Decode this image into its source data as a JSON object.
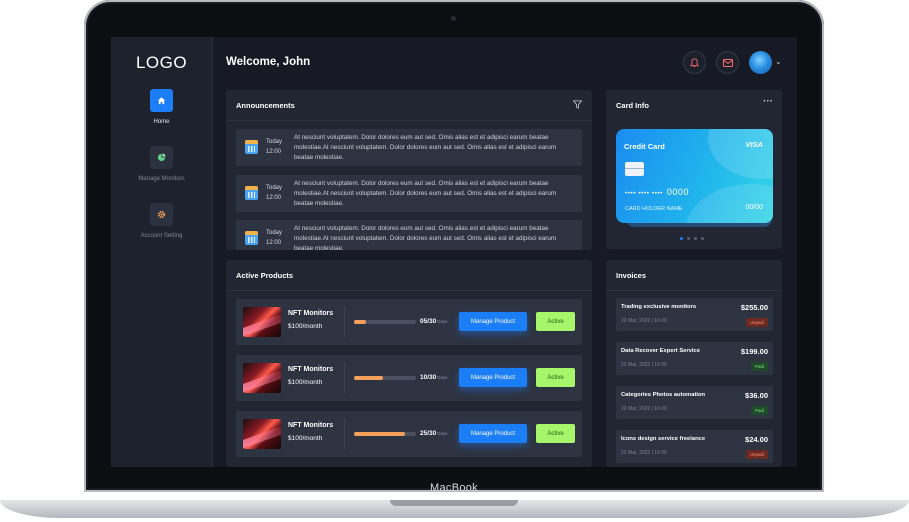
{
  "device": {
    "label": "MacBook"
  },
  "sidebar": {
    "logo": "LOGO",
    "items": [
      {
        "label": "Home",
        "icon": "home-icon",
        "active": true
      },
      {
        "label": "Manage Monitors",
        "icon": "pie-chart-icon",
        "active": false
      },
      {
        "label": "Account Setting",
        "icon": "gear-icon",
        "active": false
      }
    ]
  },
  "header": {
    "welcome": "Welcome, John",
    "icons": [
      "bell-icon",
      "mail-icon",
      "avatar"
    ]
  },
  "announcements": {
    "title": "Announcements",
    "items": [
      {
        "day": "Today",
        "time": "12:00",
        "text": "At nesciunt voluptatem. Dolor dolores eum aut sed. Omis alias est et adipisci earum beatae molestiae.At nesciunt voluptatem. Dolor dolores eum aut sed. Omis alias est et adipisci earum beatae molestiae."
      },
      {
        "day": "Today",
        "time": "12:00",
        "text": "At nesciunt voluptatem. Dolor dolores eum aut sed. Omis alias est et adipisci earum beatae molestiae.At nesciunt voluptatem. Dolor dolores eum aut sed. Omis alias est et adipisci earum beatae molestiae."
      },
      {
        "day": "Today",
        "time": "12:00",
        "text": "At nesciunt voluptatem. Dolor dolores eum aut sed. Omis alias est et adipisci earum beatae molestiae.At nesciunt voluptatem. Dolor dolores eum aut sed. Omis alias est et adipisci earum beatae molestiae."
      }
    ]
  },
  "card_info": {
    "title": "Card Info",
    "menu": "···",
    "card": {
      "title": "Credit Card",
      "brand": "VISA",
      "masked": "••••  ••••  ••••",
      "last4": "0000",
      "holder": "CARD HOLDER NAME",
      "expiry": "00/00"
    },
    "pager": {
      "count": 4,
      "active": 0
    }
  },
  "products": {
    "title": "Active Products",
    "manage_label": "Manage Product",
    "active_label": "Active",
    "unit": "Days",
    "items": [
      {
        "name": "NFT Monitors",
        "price": "$100/month",
        "progress": "05/30",
        "fraction": 0.2
      },
      {
        "name": "NFT Monitors",
        "price": "$100/month",
        "progress": "10/30",
        "fraction": 0.47
      },
      {
        "name": "NFT Monitors",
        "price": "$100/month",
        "progress": "25/30",
        "fraction": 0.83
      }
    ]
  },
  "invoices": {
    "title": "Invoices",
    "items": [
      {
        "name": "Trading exclusive monitors",
        "date": "22 Mar, 2022 | 16:00",
        "amount": "$255.00",
        "status": "Unpaid"
      },
      {
        "name": "Data Recover Expert Service",
        "date": "22 Mar, 2022 | 16:00",
        "amount": "$199.00",
        "status": "Paid"
      },
      {
        "name": "Categories Photos automation",
        "date": "22 Mar, 2022 | 16:00",
        "amount": "$36.00",
        "status": "Paid"
      },
      {
        "name": "Icons design service freelance",
        "date": "22 Mar, 2022 | 16:00",
        "amount": "$24.00",
        "status": "Unpaid"
      }
    ]
  },
  "colors": {
    "accent": "#1b7ef6",
    "active_green": "#a6f56a",
    "progress": "#f5a05a",
    "background": "#171a24",
    "panel": "#222633"
  }
}
